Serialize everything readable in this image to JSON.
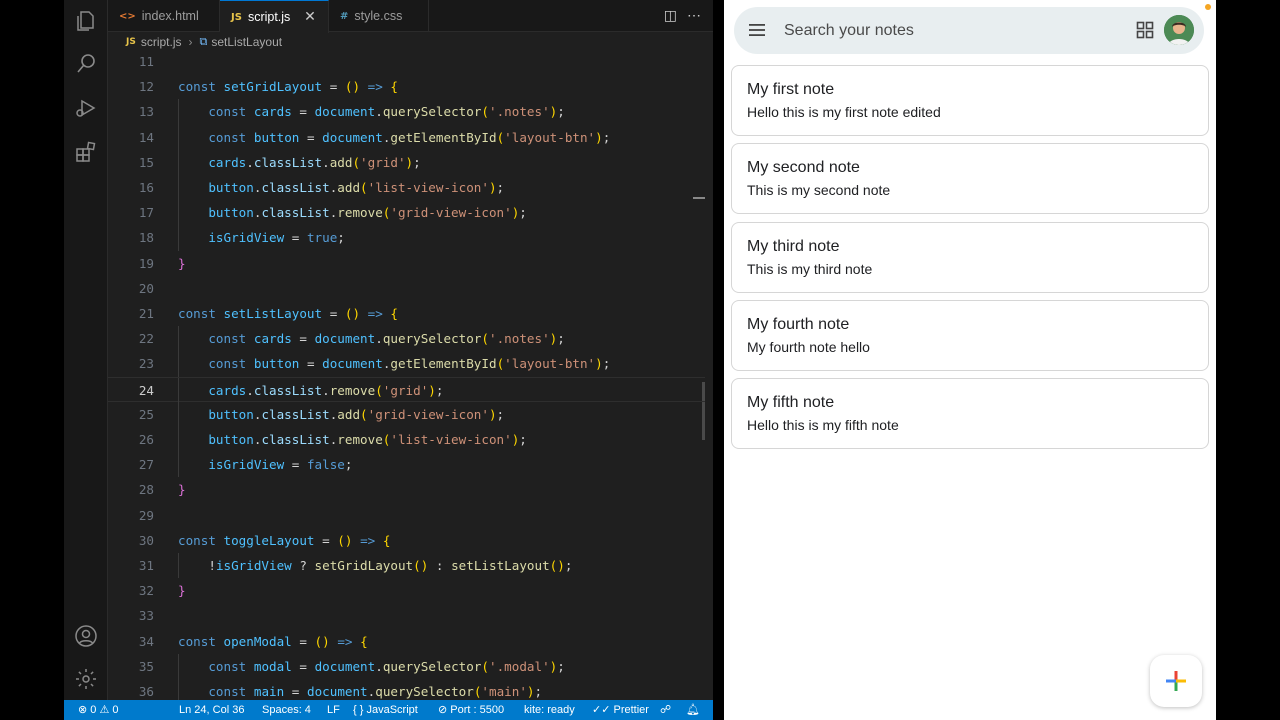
{
  "editor": {
    "tabs": [
      {
        "label": "index.html",
        "icon": "html-file-icon",
        "active": false
      },
      {
        "label": "script.js",
        "icon": "js-file-icon",
        "active": true
      },
      {
        "label": "style.css",
        "icon": "css-file-icon",
        "active": false
      }
    ],
    "breadcrumb": {
      "file": "script.js",
      "symbol": "setListLayout"
    },
    "current_line": 24,
    "lines": [
      {
        "n": "11",
        "text": ""
      },
      {
        "n": "12",
        "text": "const setGridLayout = () => {"
      },
      {
        "n": "13",
        "text": "    const cards = document.querySelector('.notes');"
      },
      {
        "n": "14",
        "text": "    const button = document.getElementById('layout-btn');"
      },
      {
        "n": "15",
        "text": "    cards.classList.add('grid');"
      },
      {
        "n": "16",
        "text": "    button.classList.add('list-view-icon');"
      },
      {
        "n": "17",
        "text": "    button.classList.remove('grid-view-icon');"
      },
      {
        "n": "18",
        "text": "    isGridView = true;"
      },
      {
        "n": "19",
        "text": "}"
      },
      {
        "n": "20",
        "text": ""
      },
      {
        "n": "21",
        "text": "const setListLayout = () => {"
      },
      {
        "n": "22",
        "text": "    const cards = document.querySelector('.notes');"
      },
      {
        "n": "23",
        "text": "    const button = document.getElementById('layout-btn');"
      },
      {
        "n": "24",
        "text": "    cards.classList.remove('grid');"
      },
      {
        "n": "25",
        "text": "    button.classList.add('grid-view-icon');"
      },
      {
        "n": "26",
        "text": "    button.classList.remove('list-view-icon');"
      },
      {
        "n": "27",
        "text": "    isGridView = false;"
      },
      {
        "n": "28",
        "text": "}"
      },
      {
        "n": "29",
        "text": ""
      },
      {
        "n": "30",
        "text": "const toggleLayout = () => {"
      },
      {
        "n": "31",
        "text": "    !isGridView ? setGridLayout() : setListLayout();"
      },
      {
        "n": "32",
        "text": "}"
      },
      {
        "n": "33",
        "text": ""
      },
      {
        "n": "34",
        "text": "const openModal = () => {"
      },
      {
        "n": "35",
        "text": "    const modal = document.querySelector('.modal');"
      },
      {
        "n": "36",
        "text": "    const main = document.querySelector('main');"
      }
    ]
  },
  "statusbar": {
    "problems": "⊗ 0 ⚠ 0",
    "position": "Ln 24, Col 36",
    "spaces": "Spaces: 4",
    "eol": "LF",
    "language": "{ } JavaScript",
    "port": "⊘ Port : 5500",
    "kite": "kite: ready",
    "prettier": "✓✓ Prettier"
  },
  "notes_app": {
    "search_placeholder": "Search your notes",
    "notes": [
      {
        "title": "My first note",
        "body": "Hello this is my first note edited"
      },
      {
        "title": "My second note",
        "body": "This is my second note"
      },
      {
        "title": "My third note",
        "body": "This is my third note"
      },
      {
        "title": "My fourth note",
        "body": "My fourth note hello"
      },
      {
        "title": "My fifth note",
        "body": "Hello this is my fifth note"
      }
    ],
    "fab_icon": "plus-icon",
    "colors": {
      "search_bg": "#e8eef0",
      "note_border": "#d6d6d6",
      "accent_orange": "#f5a623"
    }
  }
}
